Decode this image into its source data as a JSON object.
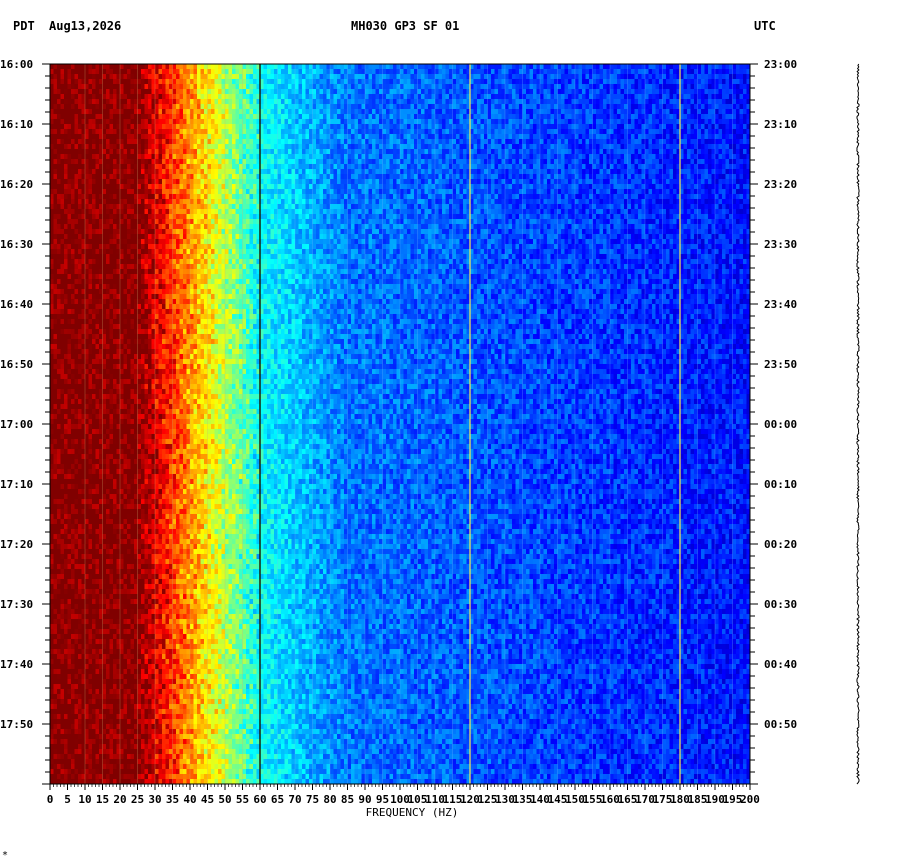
{
  "header": {
    "left_tz": "PDT",
    "date": "Aug13,2026",
    "station": "MH030 GP3 SF 01",
    "right_tz": "UTC"
  },
  "footer_mark": "*",
  "chart_data": {
    "type": "heatmap",
    "title": "MH030 GP3 SF 01",
    "xlabel": "FREQUENCY (HZ)",
    "ylabel": "",
    "xlim": [
      0,
      200
    ],
    "x_ticks": [
      0,
      5,
      10,
      15,
      20,
      25,
      30,
      35,
      40,
      45,
      50,
      55,
      60,
      65,
      70,
      75,
      80,
      85,
      90,
      95,
      100,
      105,
      110,
      115,
      120,
      125,
      130,
      135,
      140,
      145,
      150,
      155,
      160,
      165,
      170,
      175,
      180,
      185,
      190,
      195,
      200
    ],
    "y_ticks_left": [
      "16:00",
      "16:10",
      "16:20",
      "16:30",
      "16:40",
      "16:50",
      "17:00",
      "17:10",
      "17:20",
      "17:30",
      "17:40",
      "17:50"
    ],
    "y_ticks_right": [
      "23:00",
      "23:10",
      "23:20",
      "23:30",
      "23:40",
      "23:50",
      "00:00",
      "00:10",
      "00:20",
      "00:30",
      "00:40",
      "00:50"
    ],
    "time_span_minutes": 120,
    "colormap": [
      "#800000",
      "#ff0000",
      "#ffa500",
      "#ffff00",
      "#00ffff",
      "#0080ff",
      "#0000c0"
    ],
    "spectral_lines_hz": [
      60,
      120,
      180
    ],
    "description_levels": {
      "0_to_25_hz": "highest (dark red)",
      "25_to_55_hz": "red-orange-yellow transition",
      "55_to_80_hz": "cyan",
      "80_to_200_hz": "blue"
    }
  }
}
